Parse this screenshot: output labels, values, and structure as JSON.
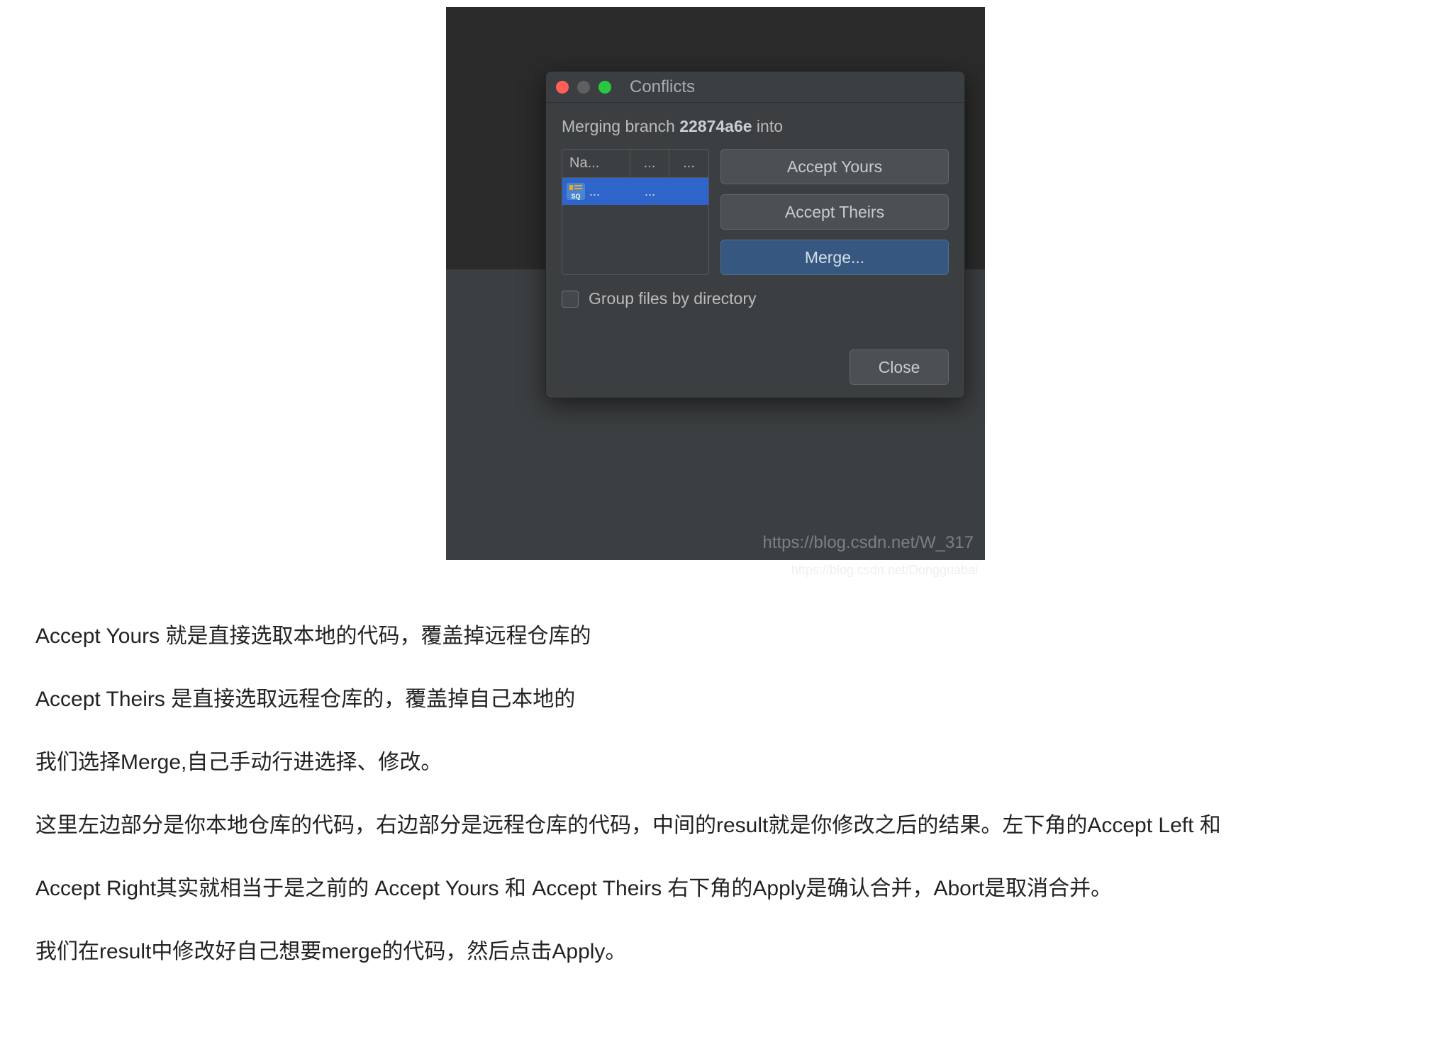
{
  "dialog": {
    "title": "Conflicts",
    "merging_prefix": "Merging branch ",
    "branch_name": "22874a6e",
    "merging_suffix": " into",
    "table": {
      "headers": [
        "Na...",
        "...",
        "..."
      ],
      "row": {
        "icon_label": "SQ",
        "cells": [
          "...",
          "..."
        ]
      }
    },
    "buttons": {
      "accept_yours": "Accept Yours",
      "accept_theirs": "Accept Theirs",
      "merge": "Merge...",
      "close": "Close"
    },
    "checkbox_label": "Group files by directory"
  },
  "watermarks": {
    "inner": "https://blog.csdn.net/W_317",
    "outer": "https://blog.csdn.net/Dongguabai"
  },
  "article": {
    "p1": "Accept Yours 就是直接选取本地的代码，覆盖掉远程仓库的",
    "p2": "Accept Theirs 是直接选取远程仓库的，覆盖掉自己本地的",
    "p3": "我们选择Merge,自己手动行进选择、修改。",
    "p4": "这里左边部分是你本地仓库的代码，右边部分是远程仓库的代码，中间的result就是你修改之后的结果。左下角的Accept Left 和",
    "p5": "Accept Right其实就相当于是之前的 Accept Yours 和 Accept Theirs  右下角的Apply是确认合并，Abort是取消合并。",
    "p6": "我们在result中修改好自己想要merge的代码，然后点击Apply。"
  }
}
